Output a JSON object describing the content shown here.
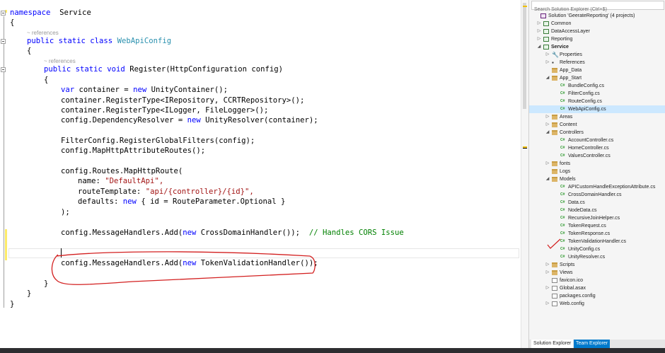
{
  "editor": {
    "codelens": [
      "~ references",
      "~ references"
    ],
    "lines": {
      "l1": {
        "kw": "namespace",
        "name": "Service"
      },
      "l2": "{",
      "l3": {
        "mods": "public static class",
        "name": "WebApiConfig"
      },
      "l4": "{",
      "l5": {
        "mods": "public static void",
        "rest": "Register(HttpConfiguration config)"
      },
      "l6": "{",
      "l7": {
        "kw": "var",
        "mid": "container =",
        "kw2": "new",
        "rest": "UnityContainer();"
      },
      "l8": "container.RegisterType<IRepository, CCRTRepository>();",
      "l9": "container.RegisterType<ILogger, FileLogger>();",
      "l10": {
        "pre": "config.DependencyResolver =",
        "kw": "new",
        "rest": "UnityResolver(container);"
      },
      "l11": "FilterConfig.RegisterGlobalFilters(config);",
      "l12": "config.MapHttpAttributeRoutes();",
      "l13": "config.Routes.MapHttpRoute(",
      "l14": {
        "pre": "name:",
        "str": "\"DefaultApi\","
      },
      "l15": {
        "pre": "routeTemplate:",
        "str": "\"api/{controller}/{id}\","
      },
      "l16": {
        "pre": "defaults:",
        "kw": "new",
        "rest": "{ id = RouteParameter.Optional }"
      },
      "l17": ");",
      "l18": {
        "pre": "config.MessageHandlers.Add(",
        "kw": "new",
        "rest": "CrossDomainHandler());",
        "comment": "// Handles CORS Issue"
      },
      "l19": {
        "pre": "config.MessageHandlers.Add(",
        "kw": "new",
        "rest": "TokenValidationHandler());"
      },
      "l20": "}",
      "l21": "}",
      "l22": "}"
    }
  },
  "solution_explorer": {
    "search_placeholder": "Search Solution Explorer (Ctrl+$)",
    "solution": "Solution 'GeerateReporting' (4 projects)",
    "items": {
      "common": "Common",
      "dal": "DataAccessLayer",
      "reporting": "Reporting",
      "service": "Service",
      "properties": "Properties",
      "references": "References",
      "app_data": "App_Data",
      "app_start": "App_Start",
      "bundle": "BundleConfig.cs",
      "filter": "FilterConfig.cs",
      "route": "RouteConfig.cs",
      "webapi": "WebApiConfig.cs",
      "areas": "Areas",
      "content": "Content",
      "controllers": "Controllers",
      "account": "AccountController.cs",
      "home": "HomeController.cs",
      "values": "ValuesController.cs",
      "fonts": "fonts",
      "logs": "Logs",
      "models": "Models",
      "apicustom": "APICustomHandleExceptionAttribute.cs",
      "crossdomain": "CrossDomainHandler.cs",
      "data": "Data.cs",
      "nodedata": "NodeData.cs",
      "recursive": "RecursiveJoinHelper.cs",
      "tokenrequest": "TokenRequest.cs",
      "tokenresponse": "TokenResponse.cs",
      "tokenvalidation": "TokenValidationHandler.cs",
      "unityconfig": "UnityConfig.cs",
      "unityresolver": "UnityResolver.cs",
      "scripts": "Scripts",
      "views": "Views",
      "favicon": "favicon.ico",
      "global": "Global.asax",
      "packages": "packages.config",
      "webconfig": "Web.config"
    },
    "tabs": {
      "solution_explorer": "Solution Explorer",
      "team_explorer": "Team Explorer"
    }
  },
  "icons": {
    "expanded": "◢",
    "collapsed": "▷",
    "cs_glyph": "C#"
  },
  "colors": {
    "keyword": "#0000ff",
    "type": "#2b91af",
    "string": "#a31515",
    "comment": "#008000",
    "annotation": "#d32020",
    "selection": "#cce8ff",
    "tab_active": "#007acc"
  }
}
